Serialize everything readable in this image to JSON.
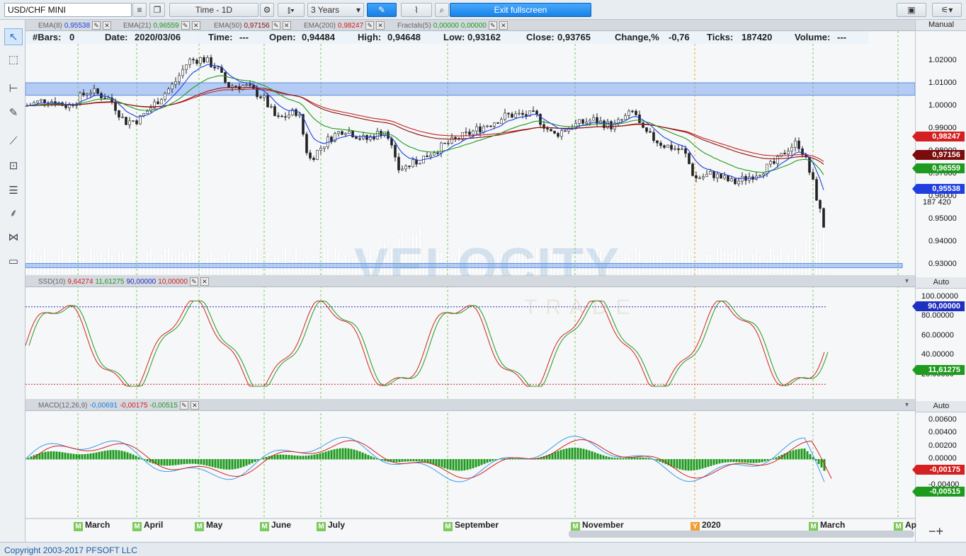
{
  "toolbar": {
    "symbol": "USD/CHF MINI",
    "timeframe": "Time - 1D",
    "period": "3 Years",
    "exit_fullscreen": "Exit fullscreen"
  },
  "indicators_main": [
    {
      "name": "EMA(8)",
      "value": "0,95538",
      "color": "#1f3fe0"
    },
    {
      "name": "EMA(21)",
      "value": "0,96559",
      "color": "#1e9a1e"
    },
    {
      "name": "EMA(50)",
      "value": "0,97156",
      "color": "#8a1010"
    },
    {
      "name": "EMA(200)",
      "value": "0,98247",
      "color": "#d42020"
    },
    {
      "name": "Fractals(5)",
      "value": "0,00000  0,00000",
      "color": "#1e9a1e"
    }
  ],
  "infobar": {
    "bars_label": "#Bars:",
    "bars": "0",
    "date_label": "Date:",
    "date": "2020/03/06",
    "time_label": "Time:",
    "time": "---",
    "open_label": "Open:",
    "open": "0,94484",
    "high_label": "High:",
    "high": "0,94648",
    "low_label": "Low:",
    "low": "0,93162",
    "close_label": "Close:",
    "close": "0,93765",
    "change_label": "Change,%",
    "change": "-0,76",
    "ticks_label": "Ticks:",
    "ticks": "187420",
    "volume_label": "Volume:",
    "volume": "---"
  },
  "ssd": {
    "name": "SSD(10)",
    "v1": "9,64274",
    "v2": "11,61275",
    "v3": "90,00000",
    "v4": "10,00000"
  },
  "macd": {
    "name": "MACD(12,26,9)",
    "v1": "-0,00691",
    "v2": "-0,00175",
    "v3": "-0,00515"
  },
  "axis": {
    "main_mode": "Manual",
    "ssd_mode": "Auto",
    "macd_mode": "Auto",
    "price_ticks": [
      "1.02000",
      "1.01000",
      "1.00000",
      "0.99000",
      "0.98000",
      "0.97000",
      "0.96000",
      "0.95000",
      "0.94000",
      "0.93000"
    ],
    "ssd_ticks": [
      "100.00000",
      "80.00000",
      "60.00000",
      "40.00000",
      "20.00000"
    ],
    "macd_ticks": [
      "0.00600",
      "0.00400",
      "0.00200",
      "0.00000",
      "-0.00200",
      "-0.00400"
    ],
    "badges_main": [
      {
        "label": "0,98247",
        "color": "#d42020"
      },
      {
        "label": "0,97156",
        "color": "#7a0c0c"
      },
      {
        "label": "0,96559",
        "color": "#1e9a1e"
      },
      {
        "label": "0,95538",
        "color": "#1f3fe0"
      }
    ],
    "volume_label": "187 420",
    "badge_ssd_top": {
      "label": "90,00000",
      "color": "#1f2fc0"
    },
    "badge_ssd_val": {
      "label": "11,61275",
      "color": "#1e9a1e"
    },
    "badge_macd_1": {
      "label": "-0,00175",
      "color": "#d42020"
    },
    "badge_macd_2": {
      "label": "-0,00515",
      "color": "#1e9a1e"
    }
  },
  "months": [
    {
      "label": "March",
      "type": "M"
    },
    {
      "label": "April",
      "type": "M"
    },
    {
      "label": "May",
      "type": "M"
    },
    {
      "label": "June",
      "type": "M"
    },
    {
      "label": "July",
      "type": "M"
    },
    {
      "label": "September",
      "type": "M"
    },
    {
      "label": "November",
      "type": "M"
    },
    {
      "label": "2020",
      "type": "Y"
    },
    {
      "label": "March",
      "type": "M"
    },
    {
      "label": "Ap",
      "type": "M"
    }
  ],
  "watermark": {
    "main": "VELOCITY",
    "sub": "TRADE"
  },
  "status": {
    "copyright": "Copyright 2003-2017 PFSOFT LLC"
  }
}
